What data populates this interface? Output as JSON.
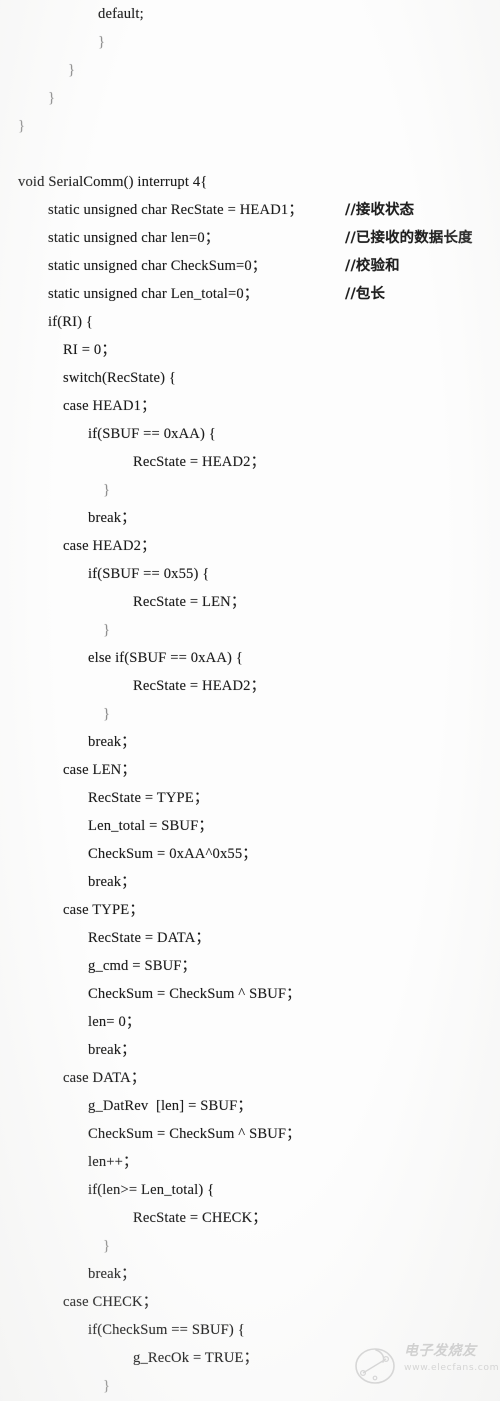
{
  "document": {
    "type": "scanned-code-listing",
    "language": "C",
    "page_background": "#fdfdfd",
    "text_color": "#1c1c1c"
  },
  "code": {
    "lines": [
      {
        "indent": 98,
        "text": "default;",
        "style": "normal"
      },
      {
        "indent": 98,
        "text": "}",
        "style": "faint"
      },
      {
        "indent": 68,
        "text": "}",
        "style": "faint"
      },
      {
        "indent": 48,
        "text": "}",
        "style": "faint"
      },
      {
        "indent": 18,
        "text": "}",
        "style": "faint"
      },
      {
        "indent": 18,
        "text": "",
        "style": "normal"
      },
      {
        "indent": 18,
        "text": "void SerialComm() interrupt 4{",
        "style": "normal"
      },
      {
        "indent": 48,
        "text": "static unsigned char RecState = HEAD1；",
        "style": "normal",
        "comment": "//接收状态"
      },
      {
        "indent": 48,
        "text": "static unsigned char len=0；",
        "style": "normal",
        "comment": "//已接收的数据长度"
      },
      {
        "indent": 48,
        "text": "static unsigned char CheckSum=0；",
        "style": "normal",
        "comment": "//校验和"
      },
      {
        "indent": 48,
        "text": "static unsigned char Len_total=0；",
        "style": "normal",
        "comment": "//包长"
      },
      {
        "indent": 48,
        "text": "if(RI) {",
        "style": "normal"
      },
      {
        "indent": 63,
        "text": "RI = 0；",
        "style": "normal"
      },
      {
        "indent": 63,
        "text": "switch(RecState) {",
        "style": "normal"
      },
      {
        "indent": 63,
        "text": "case HEAD1；",
        "style": "normal"
      },
      {
        "indent": 88,
        "text": "if(SBUF == 0xAA) {",
        "style": "normal"
      },
      {
        "indent": 133,
        "text": "RecState = HEAD2；",
        "style": "normal"
      },
      {
        "indent": 103,
        "text": "}",
        "style": "faint"
      },
      {
        "indent": 88,
        "text": "break；",
        "style": "normal"
      },
      {
        "indent": 63,
        "text": "case HEAD2；",
        "style": "normal"
      },
      {
        "indent": 88,
        "text": "if(SBUF == 0x55) {",
        "style": "normal"
      },
      {
        "indent": 133,
        "text": "RecState = LEN；",
        "style": "normal"
      },
      {
        "indent": 103,
        "text": "}",
        "style": "faint"
      },
      {
        "indent": 88,
        "text": "else if(SBUF == 0xAA) {",
        "style": "normal"
      },
      {
        "indent": 133,
        "text": "RecState = HEAD2；",
        "style": "normal"
      },
      {
        "indent": 103,
        "text": "}",
        "style": "faint"
      },
      {
        "indent": 88,
        "text": "break；",
        "style": "normal"
      },
      {
        "indent": 63,
        "text": "case LEN；",
        "style": "normal"
      },
      {
        "indent": 88,
        "text": "RecState = TYPE；",
        "style": "normal"
      },
      {
        "indent": 88,
        "text": "Len_total = SBUF；",
        "style": "normal"
      },
      {
        "indent": 88,
        "text": "CheckSum = 0xAA^0x55；",
        "style": "normal"
      },
      {
        "indent": 88,
        "text": "break；",
        "style": "normal"
      },
      {
        "indent": 63,
        "text": "case TYPE；",
        "style": "normal"
      },
      {
        "indent": 88,
        "text": "RecState = DATA；",
        "style": "normal"
      },
      {
        "indent": 88,
        "text": "g_cmd = SBUF；",
        "style": "normal"
      },
      {
        "indent": 88,
        "text": "CheckSum = CheckSum ^ SBUF；",
        "style": "normal"
      },
      {
        "indent": 88,
        "text": "len= 0；",
        "style": "normal"
      },
      {
        "indent": 88,
        "text": "break；",
        "style": "normal"
      },
      {
        "indent": 63,
        "text": "case DATA；",
        "style": "normal"
      },
      {
        "indent": 88,
        "text": "g_DatRev  [len] = SBUF；",
        "style": "normal"
      },
      {
        "indent": 88,
        "text": "CheckSum = CheckSum ^ SBUF；",
        "style": "normal"
      },
      {
        "indent": 88,
        "text": "len++；",
        "style": "normal"
      },
      {
        "indent": 88,
        "text": "if(len>= Len_total) {",
        "style": "normal"
      },
      {
        "indent": 133,
        "text": "RecState = CHECK；",
        "style": "normal"
      },
      {
        "indent": 103,
        "text": "}",
        "style": "faint"
      },
      {
        "indent": 88,
        "text": "break；",
        "style": "normal"
      },
      {
        "indent": 63,
        "text": "case CHECK；",
        "style": "normal"
      },
      {
        "indent": 88,
        "text": "if(CheckSum == SBUF) {",
        "style": "normal"
      },
      {
        "indent": 133,
        "text": "g_RecOk = TRUE；",
        "style": "normal"
      },
      {
        "indent": 103,
        "text": "}",
        "style": "faint"
      }
    ]
  },
  "watermark": {
    "brand_cn": "电子发烧友",
    "url": "www.elecfans.com",
    "color": "#9a9a9a"
  }
}
